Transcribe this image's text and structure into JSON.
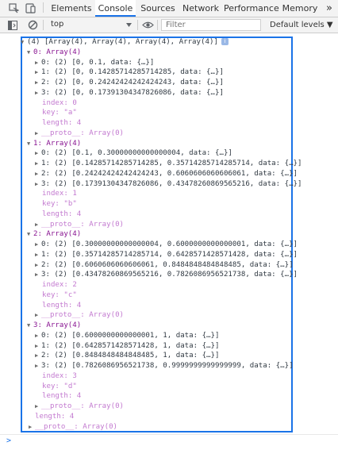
{
  "devtools": {
    "tabs": [
      {
        "label": "Elements"
      },
      {
        "label": "Console"
      },
      {
        "label": "Sources"
      },
      {
        "label": "Network"
      },
      {
        "label": "Performance"
      },
      {
        "label": "Memory"
      }
    ],
    "more_tabs": "»",
    "active_tab": "Console"
  },
  "toolbar": {
    "context": "top",
    "filter_placeholder": "Filter",
    "levels": "Default levels ▼"
  },
  "console": {
    "summary": "(4) [Array(4), Array(4), Array(4), Array(4)]",
    "info_badge": "i",
    "prompt": ">",
    "top_length": "length: 4",
    "top_proto": "__proto__: Array(0)",
    "groups": [
      {
        "head": "0: Array(4)",
        "items": [
          "0: (2) [0, 0.1, data: {…}]",
          "1: (2) [0, 0.14285714285714285, data: {…}]",
          "2: (2) [0, 0.24242424242424243, data: {…}]",
          "3: (2) [0, 0.17391304347826086, data: {…}]"
        ],
        "index": "index: 0",
        "key": "key: \"a\"",
        "length": "length: 4",
        "proto": "__proto__: Array(0)"
      },
      {
        "head": "1: Array(4)",
        "items": [
          "0: (2) [0.1, 0.30000000000000004, data: {…}]",
          "1: (2) [0.14285714285714285, 0.35714285714285714, data: {…}]",
          "2: (2) [0.24242424242424243, 0.6060606060606061, data: {…}]",
          "3: (2) [0.17391304347826086, 0.43478260869565216, data: {…}]"
        ],
        "index": "index: 1",
        "key": "key: \"b\"",
        "length": "length: 4",
        "proto": "__proto__: Array(0)"
      },
      {
        "head": "2: Array(4)",
        "items": [
          "0: (2) [0.30000000000000004, 0.6000000000000001, data: {…}]",
          "1: (2) [0.35714285714285714, 0.6428571428571428, data: {…}]",
          "2: (2) [0.6060606060606061, 0.8484848484848485, data: {…}]",
          "3: (2) [0.43478260869565216, 0.7826086956521738, data: {…}]"
        ],
        "index": "index: 2",
        "key": "key: \"c\"",
        "length": "length: 4",
        "proto": "__proto__: Array(0)"
      },
      {
        "head": "3: Array(4)",
        "items": [
          "0: (2) [0.6000000000000001, 1, data: {…}]",
          "1: (2) [0.6428571428571428, 1, data: {…}]",
          "2: (2) [0.8484848484848485, 1, data: {…}]",
          "3: (2) [0.7826086956521738, 0.9999999999999999, data: {…}]"
        ],
        "index": "index: 3",
        "key": "key: \"d\"",
        "length": "length: 4",
        "proto": "__proto__: Array(0)"
      }
    ]
  },
  "colors": {
    "accent": "#1a73e8",
    "key_purple": "#881391",
    "number_blue": "#1c00cf",
    "string_red": "#c41a16"
  }
}
